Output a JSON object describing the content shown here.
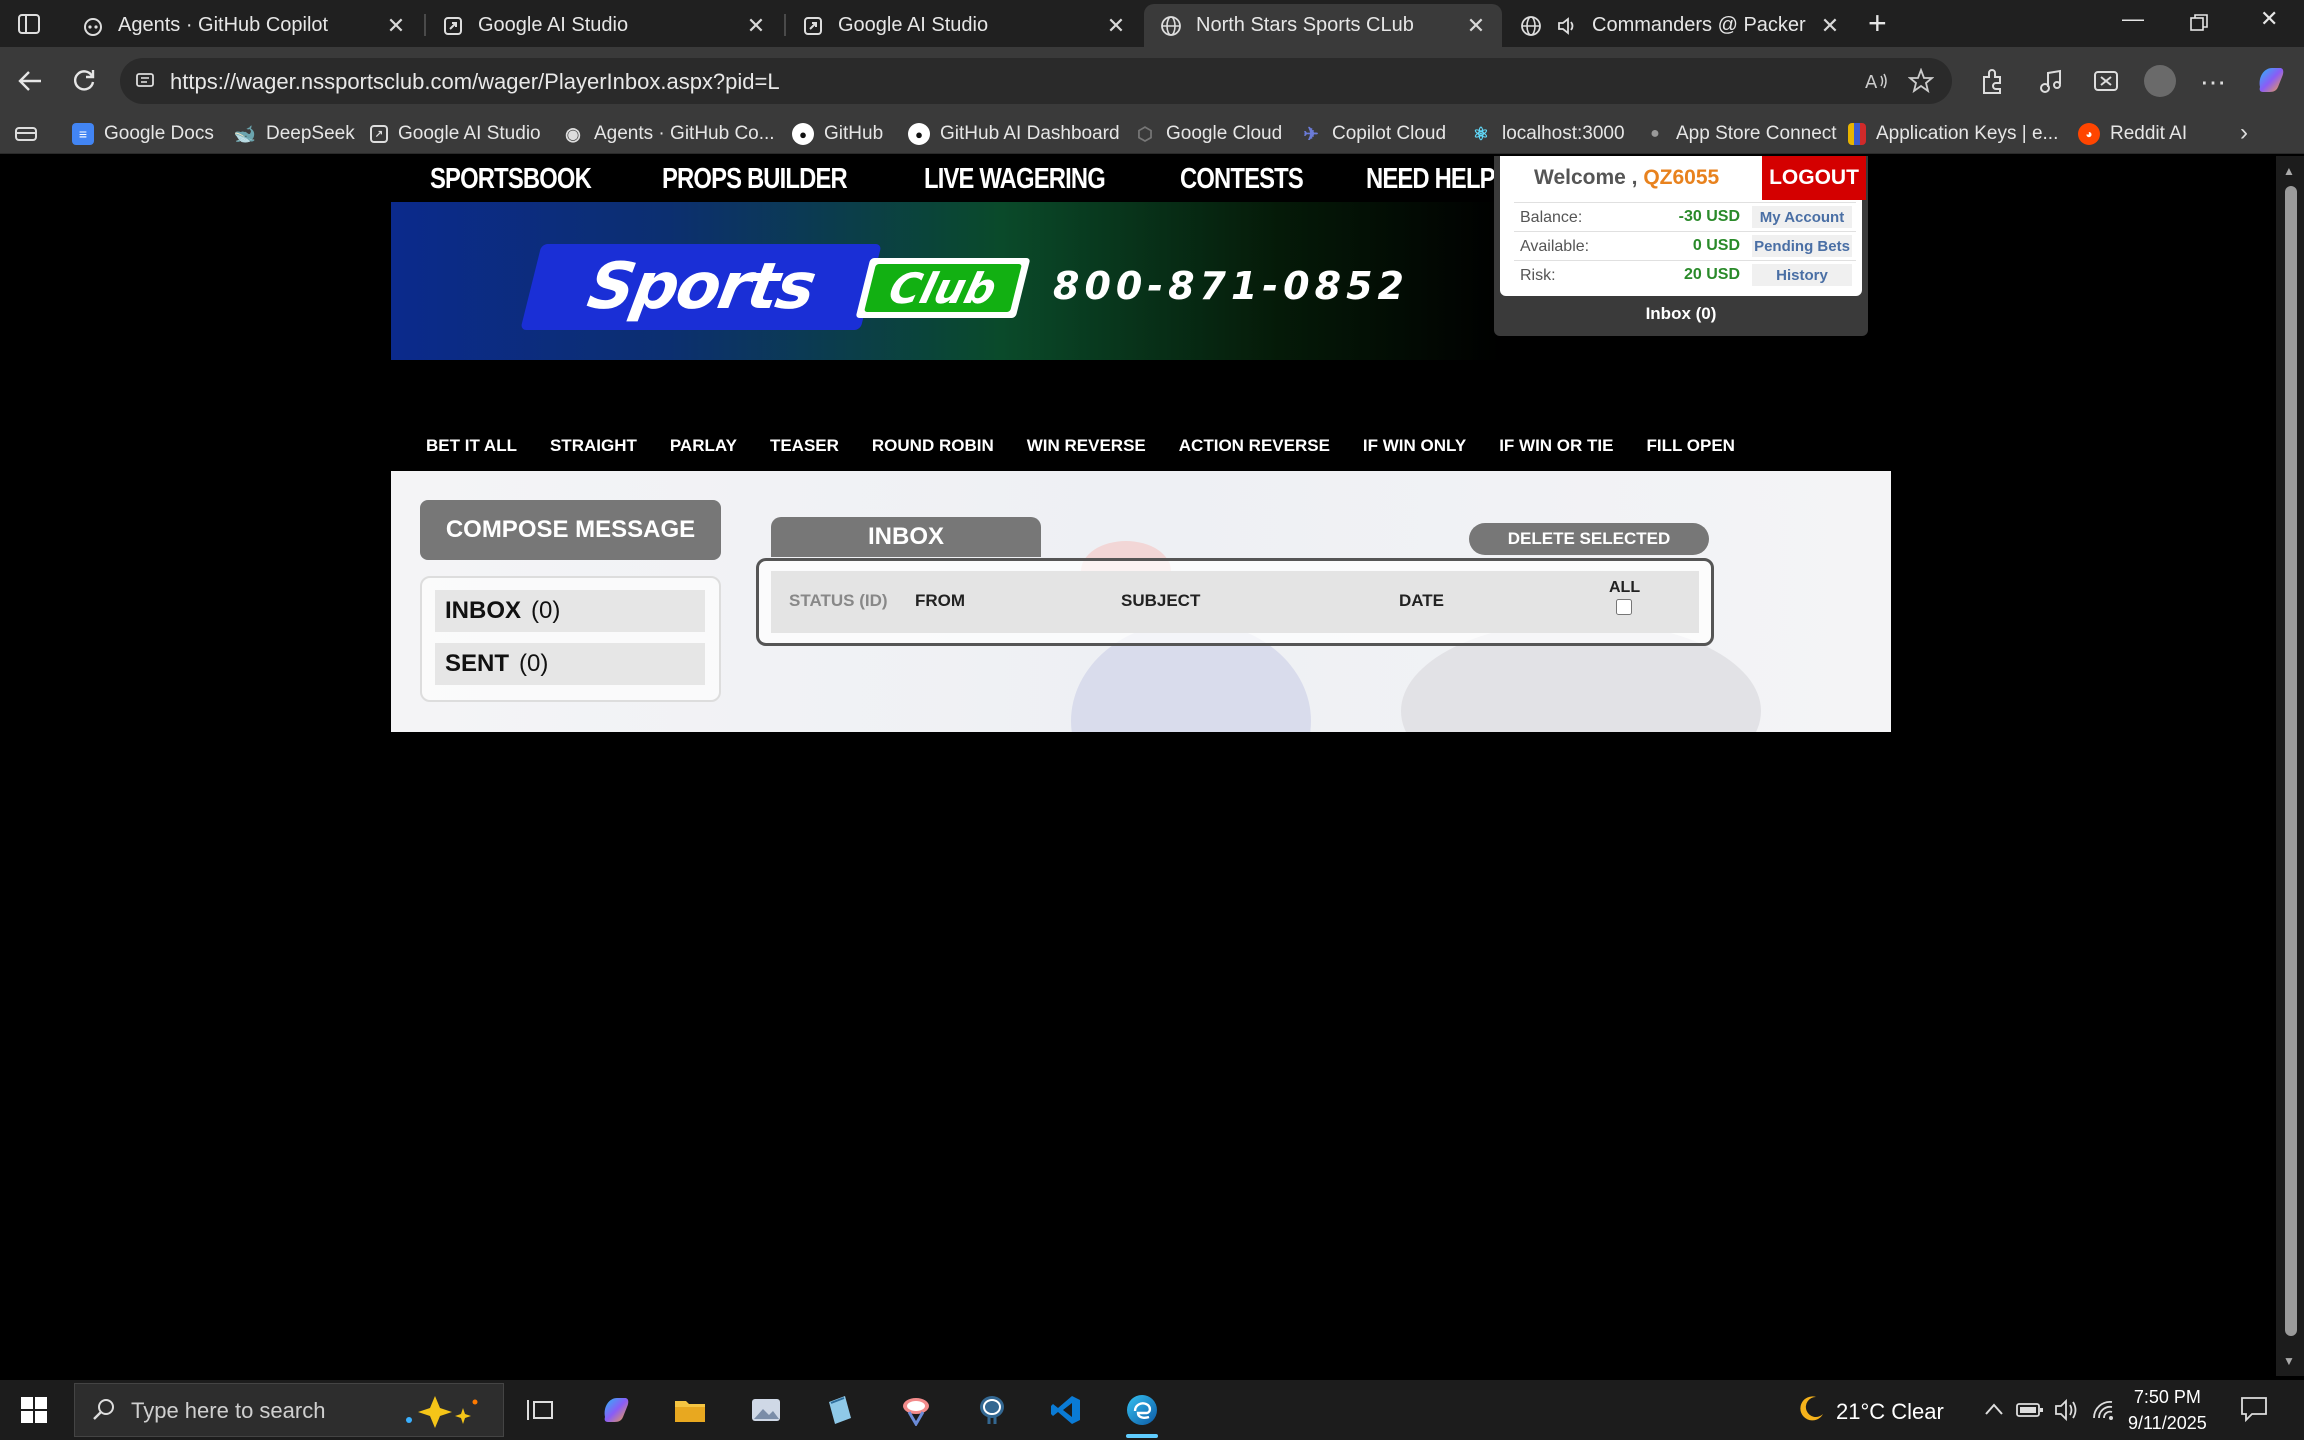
{
  "browser": {
    "tabs": [
      {
        "title": "Agents · GitHub Copilot",
        "icon": "copilot-icon",
        "active": false
      },
      {
        "title": "Google AI Studio",
        "icon": "ai-studio-icon",
        "active": false
      },
      {
        "title": "Google AI Studio",
        "icon": "ai-studio-icon",
        "active": false
      },
      {
        "title": "North Stars Sports CLub",
        "icon": "globe-icon",
        "active": true
      },
      {
        "title": "Commanders @ Packers Live",
        "icon": "globe-icon",
        "active": false
      }
    ],
    "url": "https://wager.nssportsclub.com/wager/PlayerInbox.aspx?pid=L",
    "bookmarks": [
      {
        "label": "Google Docs",
        "icon": "docs-icon",
        "color": "#4285f4"
      },
      {
        "label": "DeepSeek",
        "icon": "deepseek-icon",
        "color": "#4d6bfe"
      },
      {
        "label": "Google AI Studio",
        "icon": "ai-studio-icon",
        "color": "#ffffff"
      },
      {
        "label": "Agents · GitHub Co...",
        "icon": "copilot-icon",
        "color": "#ffffff"
      },
      {
        "label": "GitHub",
        "icon": "github-icon",
        "color": "#ffffff"
      },
      {
        "label": "GitHub AI Dashboard",
        "icon": "github-icon",
        "color": "#ffffff"
      },
      {
        "label": "Google Cloud",
        "icon": "cloud-icon",
        "color": "#888888"
      },
      {
        "label": "Copilot Cloud",
        "icon": "copilot-cloud-icon",
        "color": "#6b7bd8"
      },
      {
        "label": "localhost:3000",
        "icon": "react-icon",
        "color": "#61dafb"
      },
      {
        "label": "App Store Connect",
        "icon": "apple-icon",
        "color": "#999999"
      },
      {
        "label": "Application Keys | e...",
        "icon": "keys-icon",
        "color": "#e8b400"
      },
      {
        "label": "Reddit AI",
        "icon": "reddit-icon",
        "color": "#ff4500"
      }
    ]
  },
  "site": {
    "topnav": [
      "SPORTSBOOK",
      "PROPS BUILDER",
      "LIVE WAGERING",
      "CONTESTS",
      "NEED HELP?"
    ],
    "logo": {
      "sports": "Sports",
      "club": "Club",
      "phone": "800-871-0852"
    },
    "account": {
      "welcome": "Welcome ,",
      "username": "QZ6055",
      "logout": "LOGOUT",
      "rows": [
        {
          "label": "Balance:",
          "value": "-30 USD",
          "link": "My Account"
        },
        {
          "label": "Available:",
          "value": "0 USD",
          "link": "Pending Bets"
        },
        {
          "label": "Risk:",
          "value": "20 USD",
          "link": "History"
        }
      ],
      "inbox": "Inbox (0)"
    },
    "betnav": [
      "BET IT ALL",
      "STRAIGHT",
      "PARLAY",
      "TEASER",
      "ROUND ROBIN",
      "WIN REVERSE",
      "ACTION REVERSE",
      "IF WIN ONLY",
      "IF WIN OR TIE",
      "FILL OPEN"
    ],
    "messages": {
      "compose": "COMPOSE MESSAGE",
      "folders": [
        {
          "name": "INBOX",
          "count": "(0)"
        },
        {
          "name": "SENT",
          "count": "(0)"
        }
      ],
      "tab": "INBOX",
      "delete": "DELETE SELECTED",
      "columns": {
        "status": "STATUS (ID)",
        "from": "FROM",
        "subject": "SUBJECT",
        "date": "DATE",
        "all": "ALL"
      }
    }
  },
  "taskbar": {
    "search_placeholder": "Type here to search",
    "weather": "21°C  Clear",
    "time": "7:50 PM",
    "date": "9/11/2025"
  }
}
